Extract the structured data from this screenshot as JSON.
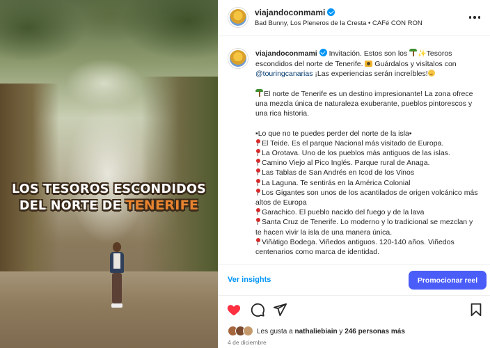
{
  "media": {
    "overlay_line1": "LOS TESOROS ESCONDIDOS",
    "overlay_line2_prefix": "DEL NORTE DE",
    "overlay_line2_accent": "TENERIFE"
  },
  "header": {
    "username": "viajandoconmami",
    "music": "Bad Bunny, Los Pleneros de la Cresta • CAFé CON RON",
    "more_icon": "more-horizontal-icon"
  },
  "caption": {
    "username": "viajandoconmami",
    "intro_a": "Invitación. Estos son los",
    "intro_b": "Tesoros escondidos del norte de Tenerife.",
    "intro_c": "Guárdalos y visítalos con",
    "mention": "@touringcanarias",
    "intro_d": "¡Las experiencias serán increíbles!",
    "para2": "El norte de Tenerife es un destino impresionante! La zona ofrece una mezcla única de naturaleza exuberante, pueblos pintorescos y una rica historia.",
    "list_header": "▪Lo que no te puedes perder del norte de la isla▪",
    "items": [
      "El Teide. Es el parque Nacional más visitado de Europa.",
      "La Orotava. Uno de los pueblos más antiguos de las islas.",
      "Camino Viejo al Pico Inglés. Parque rural de Anaga.",
      "Las Tablas de San Andrés en Icod de los Vinos",
      "La Laguna. Te sentirás en la América Colonial",
      "Los Gigantes son unos de los acantilados de origen volcánico más altos de Europa",
      "Garachico. El pueblo nacido del fuego y de la lava",
      "Santa Cruz de Tenerife. Lo moderno y lo tradicional se mezclan y te hacen vivir la isla de una manera única.",
      "Viñátigo Bodega. Viñedos antiguos. 120-140 años. Viñedos centenarios como marca de identidad."
    ]
  },
  "insights": {
    "label": "Ver insights",
    "promote_label": "Promocionar reel"
  },
  "actions": {
    "like_icon": "heart-filled-icon",
    "comment_icon": "comment-icon",
    "share_icon": "share-icon",
    "save_icon": "bookmark-icon",
    "like_color": "#ff3040"
  },
  "likes": {
    "prefix": "Les gusta a",
    "user": "nathaliebiain",
    "middle": "y",
    "others": "246 personas más"
  },
  "date": "4 de diciembre",
  "colors": {
    "link": "#0095f6",
    "promote": "#4a5df9",
    "mention": "#00376b"
  }
}
